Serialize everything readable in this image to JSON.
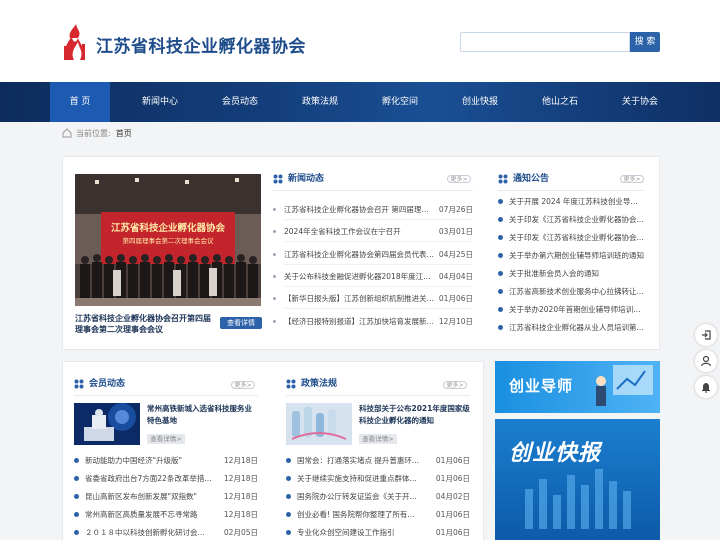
{
  "header": {
    "site_title": "江苏省科技企业孵化器协会",
    "search": {
      "placeholder": "",
      "button_label": "搜 索"
    }
  },
  "nav": {
    "items": [
      {
        "label": "首 页",
        "active": true
      },
      {
        "label": "新闻中心"
      },
      {
        "label": "会员动态"
      },
      {
        "label": "政策法规"
      },
      {
        "label": "孵化空间"
      },
      {
        "label": "创业快报"
      },
      {
        "label": "他山之石"
      },
      {
        "label": "关于协会"
      }
    ]
  },
  "breadcrumb": {
    "prefix": "当前位置:",
    "current": "首页"
  },
  "featured": {
    "banner_line1": "江苏省科技企业孵化器协会",
    "banner_line2": "第四届理事会第二次理事会会议",
    "caption": "江苏省科技企业孵化器协会召开第四届理事会第二次理事会会议",
    "button": "查看详情"
  },
  "news": {
    "title": "新闻动态",
    "more": "更多>",
    "items": [
      {
        "text": "江苏省科技企业孵化器协会召开 第四届理事会...",
        "date": "07月26日"
      },
      {
        "text": "2024年全省科技工作会议在宁召开",
        "date": "03月01日"
      },
      {
        "text": "江苏省科技企业孵化器协会第四届会员代表大...",
        "date": "04月25日"
      },
      {
        "text": "关于公布科技金融促进孵化器2018年度江苏省科...",
        "date": "04月04日"
      },
      {
        "text": "【新华日报头版】江苏创新组织机制推进关键...",
        "date": "01月06日"
      },
      {
        "text": "【经济日报特别报道】江苏加快培育发展新质...",
        "date": "12月10日"
      }
    ]
  },
  "notices": {
    "title": "通知公告",
    "more": "更多>",
    "items": [
      {
        "text": "关于开展 2024 年度江苏科技创业导师..."
      },
      {
        "text": "关于印发《江苏省科技企业孵化器协会..."
      },
      {
        "text": "关于印发《江苏省科技企业孵化器协会..."
      },
      {
        "text": "关于举办第六期创业辅导师培训班的通知"
      },
      {
        "text": "关于批准新会员入会的通知"
      },
      {
        "text": "江苏省高新技术创业服务中心拉拂转让..."
      },
      {
        "text": "关于举办2020年首期创业辅导师培训班..."
      },
      {
        "text": "江苏省科技企业孵化器从业人员培训第..."
      }
    ]
  },
  "members": {
    "title": "会员动态",
    "more": "更多>",
    "feature_title": "常州高铁新城入选省科技服务业特色基地",
    "feature_button": "查看详情>",
    "items": [
      {
        "text": "新动能助力中国经济\"升级版\"",
        "date": "12月18日"
      },
      {
        "text": "省委省政府出台7方面22条改革举措...",
        "date": "12月18日"
      },
      {
        "text": "昆山高新区发布创新发展\"双指数\"",
        "date": "12月18日"
      },
      {
        "text": "常州高新区高质量发展不忘寻常路",
        "date": "12月18日"
      },
      {
        "text": "２０１８中以科技创新孵化研讨会...",
        "date": "02月05日"
      }
    ]
  },
  "policy": {
    "title": "政策法规",
    "more": "更多>",
    "feature_title": "科技部关于公布2021年度国家级科技企业孵化器的通知",
    "feature_button": "查看详情>",
    "items": [
      {
        "text": "国常会：打通落实堵点 提升普惠环...",
        "date": "01月06日"
      },
      {
        "text": "关于继续实施支持和促进重点群体...",
        "date": "01月06日"
      },
      {
        "text": "国务院办公厅转发证监会《关于开...",
        "date": "04月02日"
      },
      {
        "text": "创业必看! 国务院帮你整理了所有...",
        "date": "01月06日"
      },
      {
        "text": "专业化众创空间建设工作指引",
        "date": "01月06日"
      }
    ]
  },
  "banners": {
    "mentor": "创业导师",
    "express": "创业快报"
  },
  "colors": {
    "brand": "#1f4d8c",
    "accent": "#2c63a8",
    "logo_red": "#d7282f"
  },
  "icons": [
    "flame-logo-icon",
    "home-icon",
    "grid-icon",
    "login-icon",
    "user-icon",
    "bell-icon"
  ]
}
